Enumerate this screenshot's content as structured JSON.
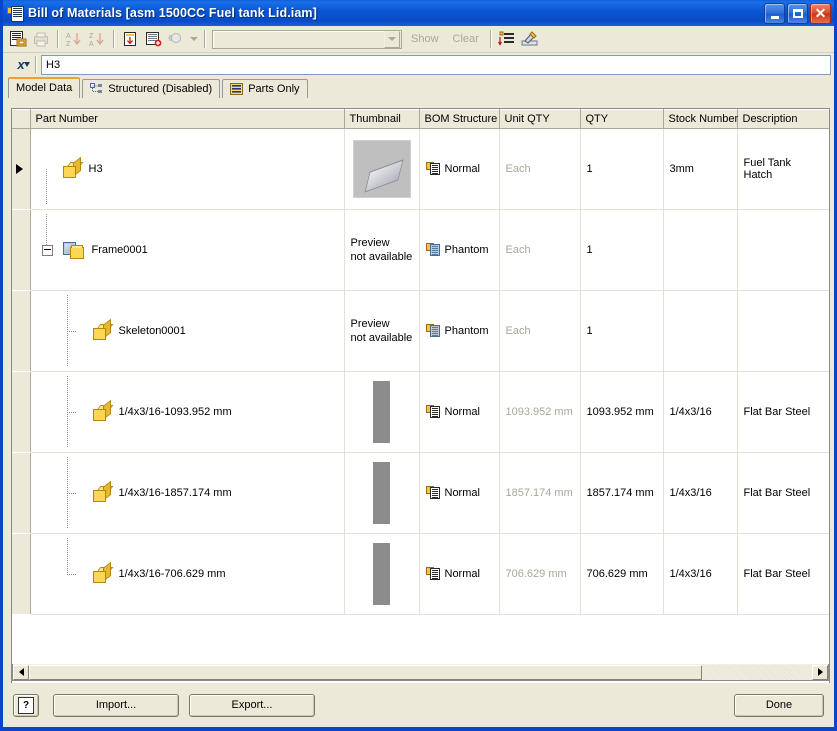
{
  "window": {
    "title": "Bill of Materials [asm 1500CC Fuel tank Lid.iam]",
    "title_icon": "bom-table-icon",
    "buttons": {
      "minimize": "minimize-icon",
      "maximize": "maximize-icon",
      "close": "✕"
    }
  },
  "toolbar": {
    "icons": [
      {
        "name": "save-bom-icon",
        "enabled": true
      },
      {
        "name": "print-icon",
        "enabled": false
      },
      {
        "name": "sort-ascending-icon",
        "enabled": false
      },
      {
        "name": "sort-descending-icon",
        "enabled": false
      },
      {
        "name": "column-chooser-icon",
        "enabled": true
      },
      {
        "name": "add-row-icon",
        "enabled": true
      },
      {
        "name": "filter-icon",
        "enabled": false
      }
    ],
    "filter_combo_value": "",
    "show_label": "Show",
    "clear_label": "Clear",
    "right_icons": [
      {
        "name": "renumber-items-icon",
        "enabled": true
      },
      {
        "name": "edit-properties-icon",
        "enabled": true
      }
    ]
  },
  "namebar": {
    "fx_icon": "rename-expression-icon",
    "value": "H3"
  },
  "tabs": [
    {
      "label": "Model Data",
      "icon": "",
      "active": true
    },
    {
      "label": "Structured (Disabled)",
      "icon": "structured-tree-icon",
      "active": false
    },
    {
      "label": "Parts Only",
      "icon": "parts-only-list-icon",
      "active": false
    }
  ],
  "grid": {
    "columns": [
      "Part Number",
      "Thumbnail",
      "BOM Structure",
      "Unit QTY",
      "QTY",
      "Stock Number",
      "Description"
    ],
    "rows": [
      {
        "part_number": "H3",
        "icon": "part-cube-icon",
        "level": 0,
        "selected": true,
        "expander": false,
        "thumbnail": "plate-preview",
        "thumbnail_text": "",
        "bom_structure": "Normal",
        "bom_icon": "normal-structure-icon",
        "unit_qty": "Each",
        "qty": "1",
        "stock_number": "3mm",
        "description": "Fuel Tank Hatch"
      },
      {
        "part_number": "Frame0001",
        "icon": "assembly-icon",
        "level": 0,
        "selected": false,
        "expander": true,
        "thumbnail": "none",
        "thumbnail_text": "Preview\nnot available",
        "bom_structure": "Phantom",
        "bom_icon": "phantom-structure-icon",
        "unit_qty": "Each",
        "qty": "1",
        "stock_number": "",
        "description": ""
      },
      {
        "part_number": "Skeleton0001",
        "icon": "part-cube-icon",
        "level": 1,
        "selected": false,
        "expander": false,
        "thumbnail": "none",
        "thumbnail_text": "Preview\nnot available",
        "bom_structure": "Phantom",
        "bom_icon": "phantom-structure-icon",
        "unit_qty": "Each",
        "qty": "1",
        "stock_number": "",
        "description": ""
      },
      {
        "part_number": "1/4x3/16-1093.952 mm",
        "icon": "part-cube-icon",
        "level": 1,
        "selected": false,
        "expander": false,
        "thumbnail": "bar",
        "thumbnail_text": "",
        "bom_structure": "Normal",
        "bom_icon": "normal-structure-icon",
        "unit_qty": "1093.952 mm",
        "qty": "1093.952 mm",
        "stock_number": "1/4x3/16",
        "description": "Flat Bar Steel"
      },
      {
        "part_number": "1/4x3/16-1857.174 mm",
        "icon": "part-cube-icon",
        "level": 1,
        "selected": false,
        "expander": false,
        "thumbnail": "bar",
        "thumbnail_text": "",
        "bom_structure": "Normal",
        "bom_icon": "normal-structure-icon",
        "unit_qty": "1857.174 mm",
        "qty": "1857.174 mm",
        "stock_number": "1/4x3/16",
        "description": "Flat Bar Steel"
      },
      {
        "part_number": "1/4x3/16-706.629 mm",
        "icon": "part-cube-icon",
        "level": 1,
        "selected": false,
        "expander": false,
        "thumbnail": "bar",
        "thumbnail_text": "",
        "bom_structure": "Normal",
        "bom_icon": "normal-structure-icon",
        "unit_qty": "706.629 mm",
        "qty": "706.629 mm",
        "stock_number": "1/4x3/16",
        "description": "Flat Bar Steel"
      }
    ]
  },
  "footer": {
    "help_label": "?",
    "import_label": "Import...",
    "export_label": "Export...",
    "done_label": "Done"
  },
  "colors": {
    "title_blue": "#0a4cc8",
    "window_face": "#ece9d8",
    "accent_orange": "#f0a030",
    "disabled_text": "#aca899",
    "part_yellow": "#fbd755"
  }
}
